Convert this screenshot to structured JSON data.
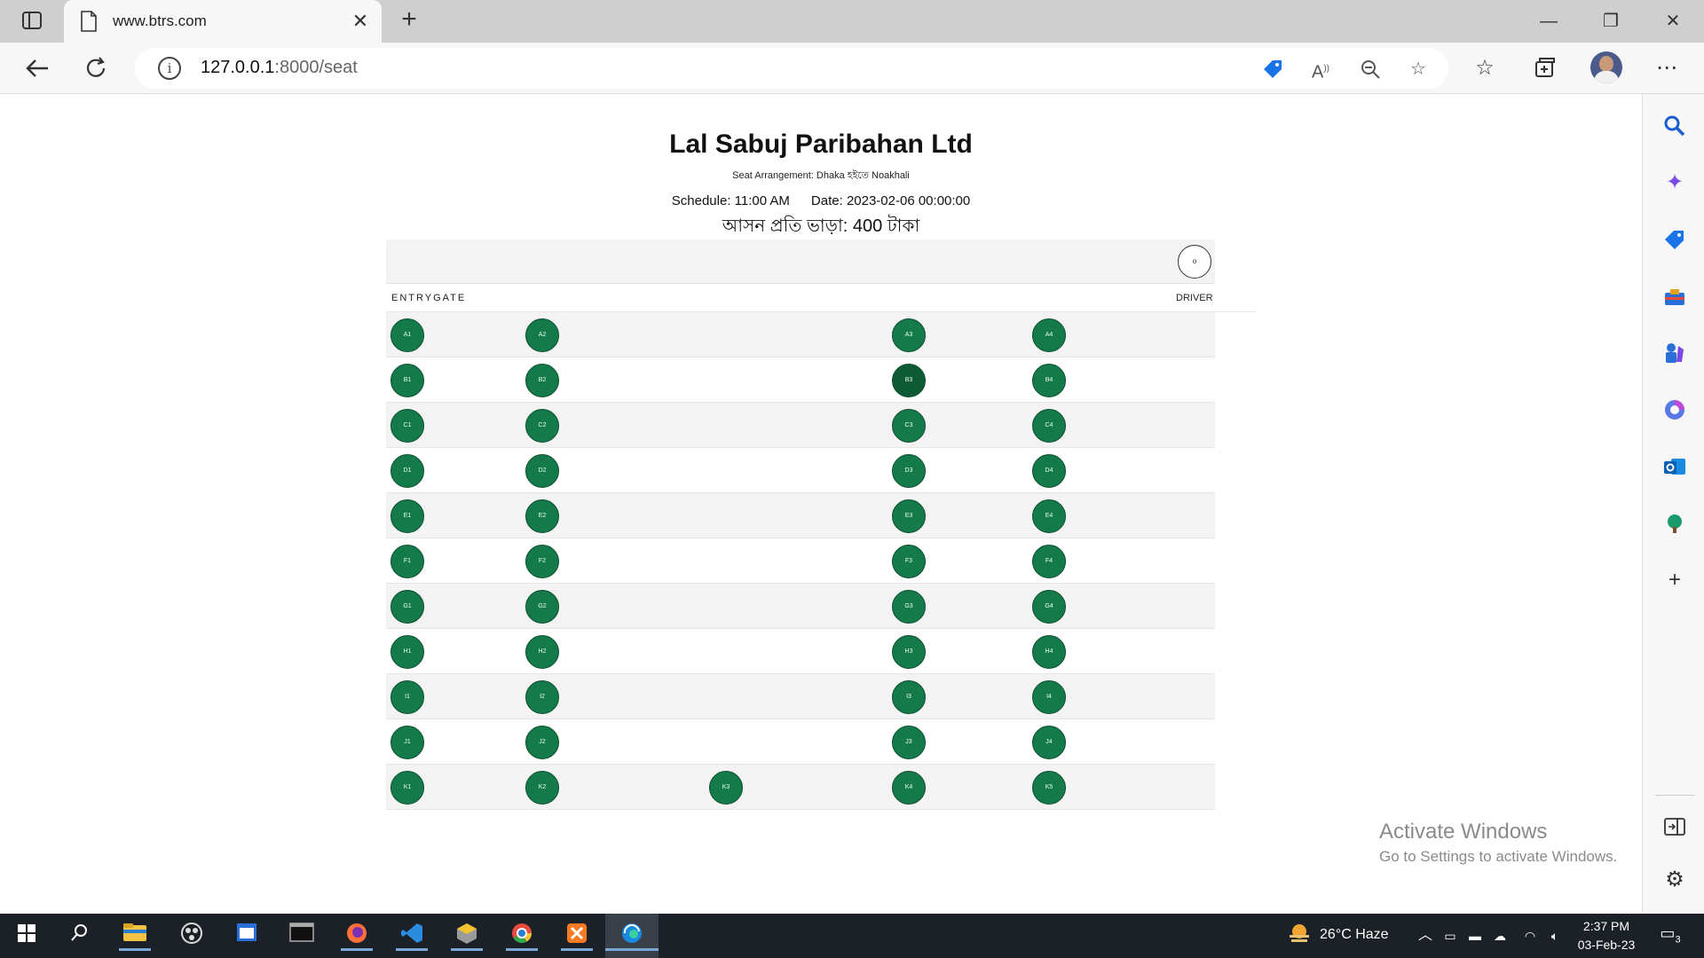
{
  "browser": {
    "tab_title": "www.btrs.com",
    "url_host": "127.0.0.1",
    "url_path": ":8000/seat"
  },
  "page": {
    "company": "Lal Sabuj Paribahan Ltd",
    "subtitle": "Seat Arrangement: Dhaka হইতে Noakhali",
    "schedule": "Schedule: 11:00 AM",
    "date": "Date: 2023-02-06 00:00:00",
    "fare": "আসন প্রতি ভাড়া: 400 টাকা",
    "steering_label": "o",
    "entry_label": "ENTRYGATE",
    "driver_label": "DRIVER"
  },
  "seat_rows": [
    [
      "A1",
      "A2",
      "A3",
      "A4"
    ],
    [
      "B1",
      "B2",
      "B3",
      "B4"
    ],
    [
      "C1",
      "C2",
      "C3",
      "C4"
    ],
    [
      "D1",
      "D2",
      "D3",
      "D4"
    ],
    [
      "E1",
      "E2",
      "E3",
      "E4"
    ],
    [
      "F1",
      "F2",
      "F3",
      "F4"
    ],
    [
      "G1",
      "G2",
      "G3",
      "G4"
    ],
    [
      "H1",
      "H2",
      "H3",
      "H4"
    ],
    [
      "I1",
      "I2",
      "I3",
      "I4"
    ],
    [
      "J1",
      "J2",
      "J3",
      "J4"
    ]
  ],
  "last_row": [
    "K1",
    "K2",
    "K3",
    "K4",
    "K5"
  ],
  "colors": {
    "seat_available": "#157a4a",
    "seat_selected": "#0e5a36"
  },
  "watermark": {
    "line1": "Activate Windows",
    "line2": "Go to Settings to activate Windows."
  },
  "taskbar": {
    "weather": "26°C  Haze",
    "time": "2:37 PM",
    "date": "03-Feb-23",
    "notifications": "3"
  }
}
